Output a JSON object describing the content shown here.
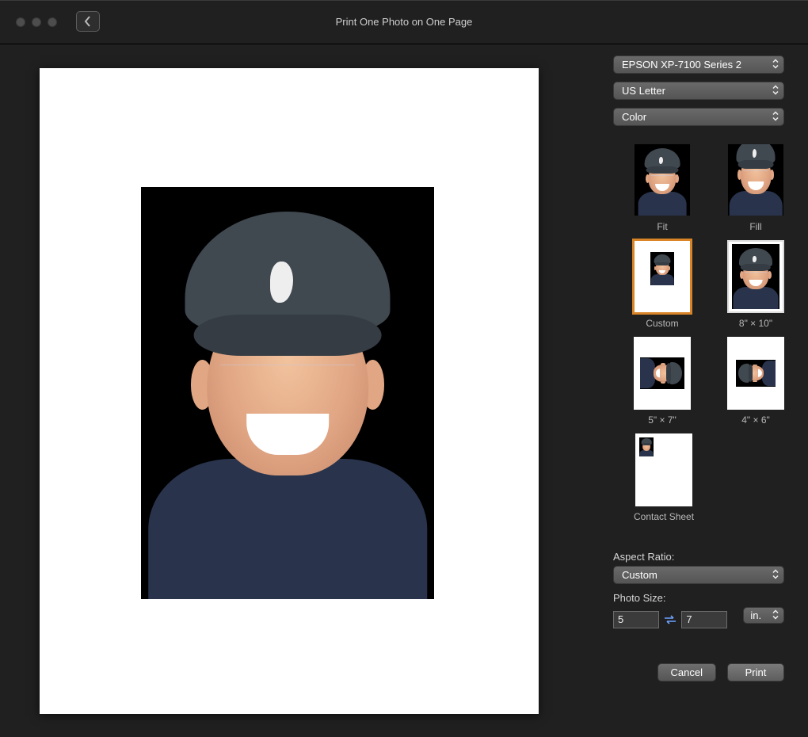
{
  "title": "Print One Photo on One Page",
  "printer": "EPSON XP-7100 Series 2",
  "paper": "US Letter",
  "color": "Color",
  "layouts": {
    "fit": "Fit",
    "fill": "Fill",
    "custom": "Custom",
    "eight_ten": "8\" × 10\"",
    "five_seven": "5\" × 7\"",
    "four_six": "4\" × 6\"",
    "contact": "Contact Sheet"
  },
  "selected_layout": "Custom",
  "aspect": {
    "label": "Aspect Ratio:",
    "value": "Custom"
  },
  "photosize": {
    "label": "Photo Size:",
    "w": "5",
    "h": "7",
    "unit": "in."
  },
  "buttons": {
    "cancel": "Cancel",
    "print": "Print"
  }
}
